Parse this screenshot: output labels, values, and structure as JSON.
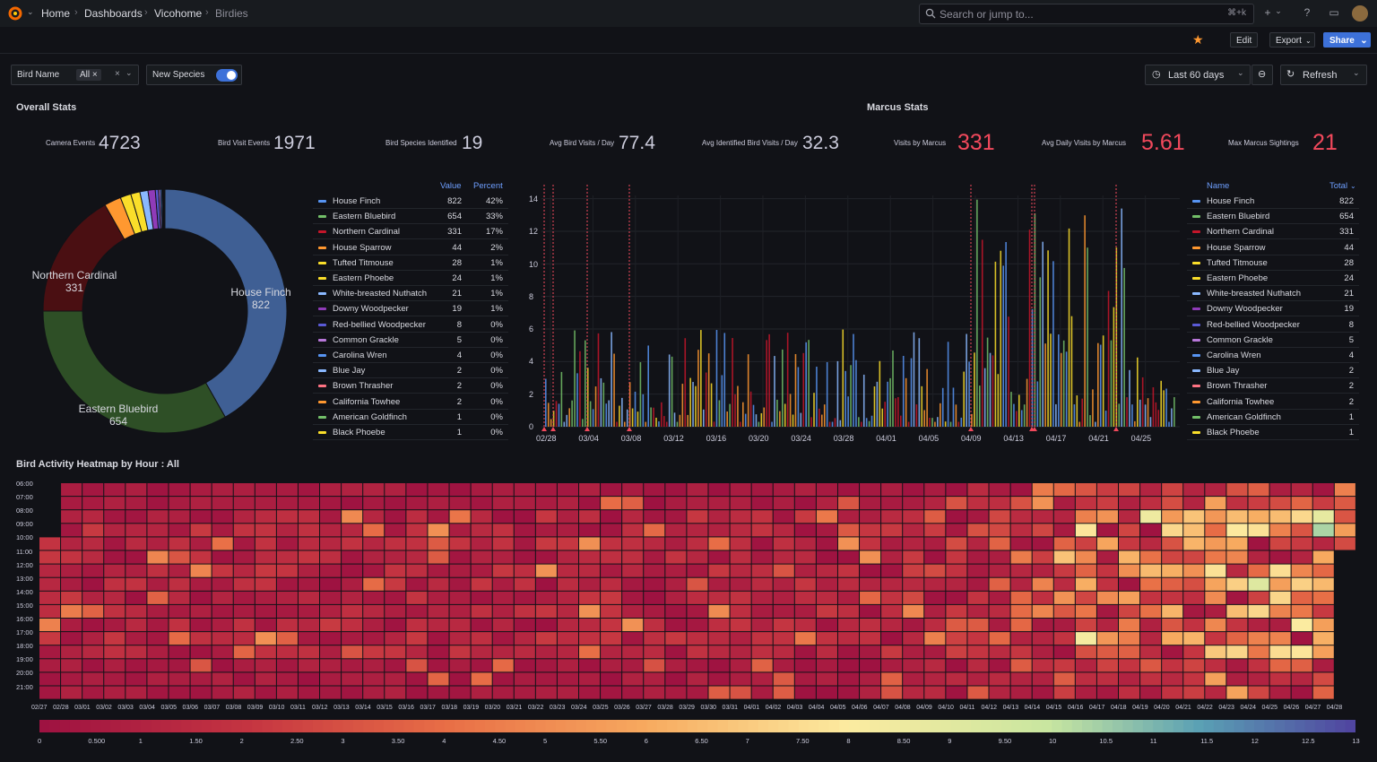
{
  "breadcrumb": [
    "Home",
    "Dashboards",
    "Vicohome",
    "Birdies"
  ],
  "search": {
    "placeholder": "Search or jump to...",
    "shortcut": "⌘+k"
  },
  "toolbar": {
    "edit": "Edit",
    "export": "Export",
    "share": "Share"
  },
  "variables": {
    "bird_name_label": "Bird Name",
    "bird_name_value": "All",
    "new_species_label": "New Species"
  },
  "time_range": {
    "label": "Last 60 days",
    "refresh": "Refresh"
  },
  "overall_stats": {
    "title": "Overall Stats",
    "items": [
      {
        "label": "Camera Events",
        "value": "4723"
      },
      {
        "label": "Bird Visit Events",
        "value": "1971"
      },
      {
        "label": "Bird Species Identified",
        "value": "19"
      },
      {
        "label": "Avg Bird Visits / Day",
        "value": "77.4"
      },
      {
        "label": "Avg Identified Bird Visits / Day",
        "value": "32.3"
      }
    ]
  },
  "marcus_stats": {
    "title": "Marcus Stats",
    "items": [
      {
        "label": "Visits by Marcus",
        "value": "331"
      },
      {
        "label": "Avg Daily Visits by Marcus",
        "value": "5.61"
      },
      {
        "label": "Max Marcus Sightings",
        "value": "21"
      }
    ]
  },
  "pie": {
    "headers": {
      "value": "Value",
      "percent": "Percent"
    },
    "labels": [
      {
        "name": "Northern Cardinal",
        "value": "331"
      },
      {
        "name": "House Finch",
        "value": "822"
      },
      {
        "name": "Eastern Bluebird",
        "value": "654"
      }
    ]
  },
  "species": [
    {
      "name": "House Finch",
      "value": 822,
      "percent": "42%",
      "color": "#5794f2"
    },
    {
      "name": "Eastern Bluebird",
      "value": 654,
      "percent": "33%",
      "color": "#73bf69"
    },
    {
      "name": "Northern Cardinal",
      "value": 331,
      "percent": "17%",
      "color": "#c4162a"
    },
    {
      "name": "House Sparrow",
      "value": 44,
      "percent": "2%",
      "color": "#ff9830"
    },
    {
      "name": "Tufted Titmouse",
      "value": 28,
      "percent": "1%",
      "color": "#fade2a"
    },
    {
      "name": "Eastern Phoebe",
      "value": 24,
      "percent": "1%",
      "color": "#fade2a"
    },
    {
      "name": "White-breasted Nuthatch",
      "value": 21,
      "percent": "1%",
      "color": "#8ab8ff"
    },
    {
      "name": "Downy Woodpecker",
      "value": 19,
      "percent": "1%",
      "color": "#8f3bb8"
    },
    {
      "name": "Red-bellied Woodpecker",
      "value": 8,
      "percent": "0%",
      "color": "#5a5ad6"
    },
    {
      "name": "Common Grackle",
      "value": 5,
      "percent": "0%",
      "color": "#b877d9"
    },
    {
      "name": "Carolina Wren",
      "value": 4,
      "percent": "0%",
      "color": "#5794f2"
    },
    {
      "name": "Blue Jay",
      "value": 2,
      "percent": "0%",
      "color": "#8ab8ff"
    },
    {
      "name": "Brown Thrasher",
      "value": 2,
      "percent": "0%",
      "color": "#ff7383"
    },
    {
      "name": "California Towhee",
      "value": 2,
      "percent": "0%",
      "color": "#ff9830"
    },
    {
      "name": "American Goldfinch",
      "value": 1,
      "percent": "0%",
      "color": "#73bf69"
    },
    {
      "name": "Black Phoebe",
      "value": 1,
      "percent": "0%",
      "color": "#fade2a"
    }
  ],
  "right_table": {
    "headers": {
      "name": "Name",
      "total": "Total"
    }
  },
  "bar_chart": {
    "y_ticks": [
      "0",
      "2",
      "4",
      "6",
      "8",
      "10",
      "12",
      "14"
    ],
    "x_ticks": [
      "02/28",
      "03/04",
      "03/08",
      "03/12",
      "03/16",
      "03/20",
      "03/24",
      "03/28",
      "04/01",
      "04/05",
      "04/09",
      "04/13",
      "04/17",
      "04/21",
      "04/25"
    ]
  },
  "heatmap": {
    "title": "Bird Activity Heatmap by Hour : All",
    "hours": [
      "06:00",
      "07:00",
      "08:00",
      "09:00",
      "10:00",
      "11:00",
      "12:00",
      "13:00",
      "14:00",
      "15:00",
      "16:00",
      "17:00",
      "18:00",
      "19:00",
      "20:00",
      "21:00"
    ],
    "dates": [
      "02/27",
      "02/28",
      "03/01",
      "03/02",
      "03/03",
      "03/04",
      "03/05",
      "03/06",
      "03/07",
      "03/08",
      "03/09",
      "03/10",
      "03/11",
      "03/12",
      "03/13",
      "03/14",
      "03/15",
      "03/16",
      "03/17",
      "03/18",
      "03/19",
      "03/20",
      "03/21",
      "03/22",
      "03/23",
      "03/24",
      "03/25",
      "03/26",
      "03/27",
      "03/28",
      "03/29",
      "03/30",
      "03/31",
      "04/01",
      "04/02",
      "04/03",
      "04/04",
      "04/05",
      "04/06",
      "04/07",
      "04/08",
      "04/09",
      "04/10",
      "04/11",
      "04/12",
      "04/13",
      "04/14",
      "04/15",
      "04/16",
      "04/17",
      "04/18",
      "04/19",
      "04/20",
      "04/21",
      "04/22",
      "04/23",
      "04/24",
      "04/25",
      "04/26",
      "04/27",
      "04/28"
    ],
    "scale_ticks": [
      "0",
      "0.500",
      "1",
      "1.50",
      "2",
      "2.50",
      "3",
      "3.50",
      "4",
      "4.50",
      "5",
      "5.50",
      "6",
      "6.50",
      "7",
      "7.50",
      "8",
      "8.50",
      "9",
      "9.50",
      "10",
      "10.5",
      "11",
      "11.5",
      "12",
      "12.5",
      "13"
    ]
  }
}
